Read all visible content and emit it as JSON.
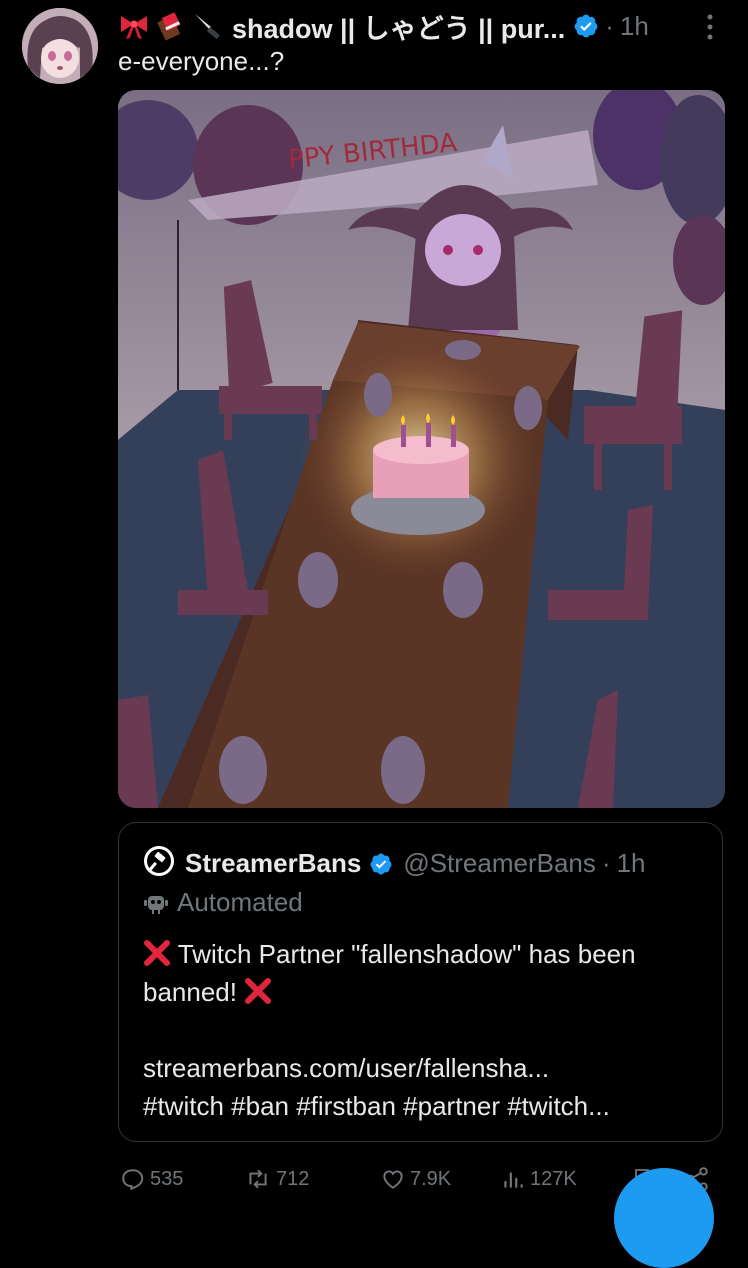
{
  "tweet": {
    "display_name": "shadow || しゃどう || pur...",
    "time": "1h",
    "dot": "·",
    "text": "e-everyone...?",
    "image": {
      "banner_text": "PPY BIRTHDA"
    }
  },
  "quote": {
    "display_name": "StreamerBans",
    "handle": "@StreamerBans",
    "dot": "·",
    "time": "1h",
    "label": "Automated",
    "line1": "Twitch Partner \"fallenshadow\" has been banned!",
    "link": "streamerbans.com/user/fallensha...",
    "hashtags": "#twitch #ban #firstban #partner #twitch..."
  },
  "actions": {
    "replies": "535",
    "reposts": "712",
    "likes": "7.9K",
    "views": "127K"
  },
  "colors": {
    "accent": "#1d9bf0",
    "muted": "#71767b",
    "border": "#2f3336",
    "cross": "#e0263c"
  }
}
